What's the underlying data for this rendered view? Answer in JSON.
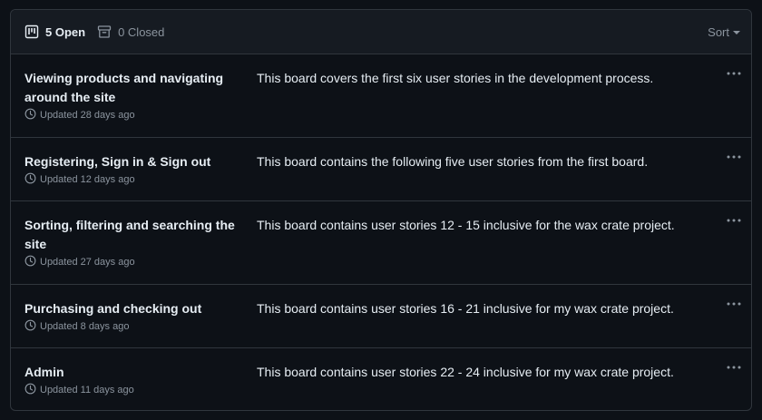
{
  "header": {
    "open_label": "5 Open",
    "closed_label": "0 Closed",
    "sort_label": "Sort",
    "open_icon": "project-board-icon",
    "closed_icon": "archive-icon"
  },
  "projects": [
    {
      "name": "Viewing products and navigating around the site",
      "description": "This board covers the first six user stories in the development process.",
      "updated": "Updated 28 days ago"
    },
    {
      "name": "Registering, Sign in & Sign out",
      "description": "This board contains the following five user stories from the first board.",
      "updated": "Updated 12 days ago"
    },
    {
      "name": "Sorting, filtering and searching the site",
      "description": "This board contains user stories 12 - 15 inclusive for the wax crate project.",
      "updated": "Updated 27 days ago"
    },
    {
      "name": "Purchasing and checking out",
      "description": "This board contains user stories 16 - 21 inclusive for my wax crate project.",
      "updated": "Updated 8 days ago"
    },
    {
      "name": "Admin",
      "description": "This board contains user stories 22 - 24 inclusive for my wax crate project.",
      "updated": "Updated 11 days ago"
    }
  ],
  "colors": {
    "background": "#0d1117",
    "header_background": "#161b22",
    "border": "#30363d",
    "text": "#e6edf3",
    "muted": "#8b949e"
  }
}
